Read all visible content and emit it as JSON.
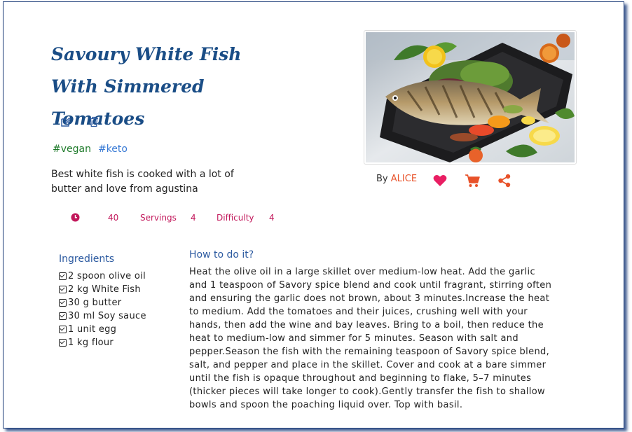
{
  "recipe": {
    "title": "Savoury White Fish With Simmered Tomatoes",
    "tags": [
      "#vegan",
      "#keto"
    ],
    "description": "Best white fish is cooked with a lot of butter and love from agustina",
    "time_value": "40",
    "servings_label": "Servings",
    "servings_value": "4",
    "difficulty_label": "Difficulty",
    "difficulty_value": "4",
    "author_prefix": "By",
    "author": "ALICE"
  },
  "icons": {
    "edit": "edit-icon",
    "delete": "trash-icon",
    "time": "clock-icon",
    "like": "heart-icon",
    "cart": "cart-icon",
    "share": "share-icon"
  },
  "colors": {
    "title": "#1a4d86",
    "tag_vegan": "#1e7a2a",
    "tag_keto": "#3a7bd5",
    "meta": "#c2185b",
    "author": "#e8522a",
    "heart": "#e91e63",
    "section_heading": "#2c5aa0"
  },
  "ingredients": {
    "title": "Ingredients",
    "items": [
      "2 spoon olive oil",
      "2 kg White Fish",
      "30 g butter",
      "30 ml Soy sauce",
      "1 unit egg",
      "1 kg flour"
    ]
  },
  "instructions": {
    "title": "How to do it?",
    "text": "Heat the olive oil in a large skillet over medium-low heat. Add the garlic and 1 teaspoon of Savory spice blend and cook until fragrant, stirring often and ensuring the garlic does not brown, about 3 minutes.Increase the heat to medium. Add the tomatoes and their juices, crushing well with your hands, then add the wine and bay leaves. Bring to a boil, then reduce the heat to medium-low and simmer for 5 minutes. Season with salt and pepper.Season the fish with the remaining teaspoon of Savory spice blend, salt, and pepper and place in the skillet. Cover and cook at a bare simmer until the fish is opaque throughout and beginning to flake, 5–7 minutes (thicker pieces will take longer to cook).Gently transfer the fish to shallow bowls and spoon the poaching liquid over. Top with basil."
  }
}
